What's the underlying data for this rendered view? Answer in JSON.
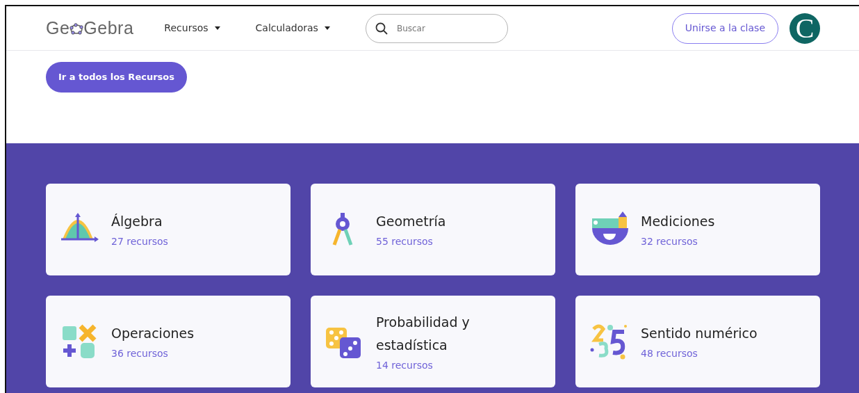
{
  "header": {
    "logo": {
      "before": "Ge",
      "after": "Gebra"
    },
    "menus": [
      {
        "label": "Recursos",
        "expanded": false
      },
      {
        "label": "Calculadoras",
        "expanded": false
      }
    ],
    "search": {
      "placeholder": "Buscar"
    },
    "join_button": "Unirse a la clase",
    "avatar": {
      "letter": "C",
      "color": "#0f6663"
    }
  },
  "all_resources_button": "Ir a todos los Recursos",
  "categories": [
    {
      "kind": "algebra",
      "title": "Álgebra",
      "count": "27 recursos"
    },
    {
      "kind": "geometry",
      "title": "Geometría",
      "count": "55 recursos"
    },
    {
      "kind": "measurement",
      "title": "Mediciones",
      "count": "32 recursos"
    },
    {
      "kind": "operations",
      "title": "Operaciones",
      "count": "36 recursos"
    },
    {
      "kind": "probability",
      "title": "Probabilidad y estadística",
      "count": "14 recursos"
    },
    {
      "kind": "numbers",
      "title": "Sentido numérico",
      "count": "48 recursos"
    }
  ]
}
